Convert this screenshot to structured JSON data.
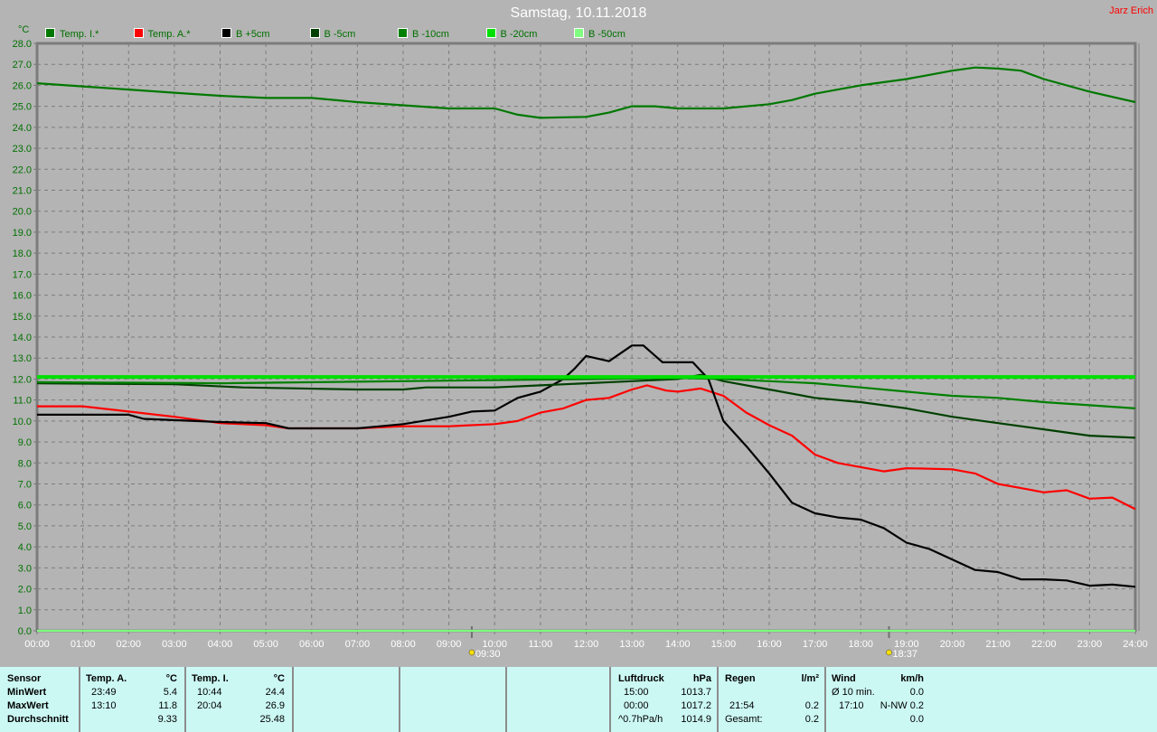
{
  "title": "Samstag, 10.11.2018",
  "author": "Jarz Erich",
  "chart_data": {
    "type": "line",
    "title": "Samstag, 10.11.2018",
    "ylabel": "°C",
    "xlabel": "",
    "ylim": [
      0,
      28
    ],
    "xlim_hours": [
      0,
      24
    ],
    "grid": true,
    "legend_position": "top-left",
    "x_tick_labels": [
      "00:00",
      "01:00",
      "02:00",
      "03:00",
      "04:00",
      "05:00",
      "06:00",
      "07:00",
      "08:00",
      "09:00",
      "10:00",
      "11:00",
      "12:00",
      "13:00",
      "14:00",
      "15:00",
      "16:00",
      "17:00",
      "18:00",
      "19:00",
      "20:00",
      "21:00",
      "22:00",
      "23:00",
      "24:00"
    ],
    "y_tick_labels": [
      "0.0",
      "1.0",
      "2.0",
      "3.0",
      "4.0",
      "5.0",
      "6.0",
      "7.0",
      "8.0",
      "9.0",
      "10.0",
      "11.0",
      "12.0",
      "13.0",
      "14.0",
      "15.0",
      "16.0",
      "17.0",
      "18.0",
      "19.0",
      "20.0",
      "21.0",
      "22.0",
      "23.0",
      "24.0",
      "25.0",
      "26.0",
      "27.0",
      "28.0"
    ],
    "annotations": [
      {
        "label": "09:30",
        "hour": 9.5,
        "icon": "sunrise-icon"
      },
      {
        "label": "18:37",
        "hour": 18.617,
        "icon": "sunset-icon"
      }
    ],
    "series": [
      {
        "name": "Temp. I.*",
        "color": "#007800",
        "x": [
          0,
          1,
          2,
          3,
          4,
          5,
          6,
          7,
          8,
          9,
          10,
          10.5,
          11,
          12,
          12.5,
          13,
          13.5,
          14,
          15,
          16,
          16.5,
          17,
          17.5,
          18,
          19,
          20,
          20.5,
          21,
          21.5,
          22,
          23,
          24
        ],
        "y": [
          26.1,
          25.95,
          25.8,
          25.65,
          25.5,
          25.4,
          25.4,
          25.2,
          25.05,
          24.9,
          24.9,
          24.6,
          24.45,
          24.5,
          24.7,
          25.0,
          25.0,
          24.9,
          24.9,
          25.1,
          25.3,
          25.6,
          25.8,
          26.0,
          26.3,
          26.7,
          26.85,
          26.8,
          26.7,
          26.3,
          25.7,
          25.2
        ]
      },
      {
        "name": "Temp. A.*",
        "color": "#ff0000",
        "x": [
          0,
          1,
          2,
          3,
          4,
          5,
          5.5,
          6,
          7,
          8,
          9,
          10,
          10.5,
          11,
          11.5,
          12,
          12.5,
          13,
          13.33,
          13.75,
          14,
          14.5,
          15,
          15.5,
          16,
          16.5,
          17,
          17.5,
          18,
          18.5,
          19,
          20,
          20.5,
          21,
          21.5,
          22,
          22.5,
          23,
          23.5,
          24
        ],
        "y": [
          10.7,
          10.7,
          10.45,
          10.2,
          9.9,
          9.8,
          9.65,
          9.65,
          9.65,
          9.75,
          9.75,
          9.85,
          10.0,
          10.4,
          10.6,
          11.0,
          11.1,
          11.5,
          11.7,
          11.45,
          11.4,
          11.55,
          11.2,
          10.4,
          9.8,
          9.3,
          8.4,
          8.0,
          7.8,
          7.6,
          7.75,
          7.7,
          7.5,
          7.0,
          6.8,
          6.6,
          6.7,
          6.3,
          6.35,
          5.8
        ]
      },
      {
        "name": "B +5cm",
        "color": "#000000",
        "x": [
          0,
          2,
          2.33,
          4,
          5,
          5.5,
          7,
          7.5,
          8,
          9,
          9.5,
          10,
          10.5,
          11,
          11.5,
          11.75,
          12,
          12.5,
          13,
          13.25,
          13.67,
          14,
          14.33,
          14.67,
          15,
          15.5,
          16,
          16.5,
          17,
          17.5,
          18,
          18.5,
          19,
          19.5,
          20,
          20.5,
          21,
          21.5,
          22,
          22.5,
          23,
          23.5,
          24
        ],
        "y": [
          10.3,
          10.3,
          10.1,
          9.95,
          9.9,
          9.65,
          9.65,
          9.75,
          9.85,
          10.2,
          10.45,
          10.5,
          11.1,
          11.4,
          12.0,
          12.5,
          13.1,
          12.85,
          13.6,
          13.6,
          12.8,
          12.8,
          12.8,
          12.0,
          10.0,
          8.8,
          7.5,
          6.1,
          5.6,
          5.4,
          5.3,
          4.9,
          4.2,
          3.9,
          3.4,
          2.9,
          2.8,
          2.45,
          2.45,
          2.4,
          2.15,
          2.2,
          2.1
        ]
      },
      {
        "name": "B -5cm",
        "color": "#004000",
        "x": [
          0,
          3,
          4.5,
          7,
          8,
          8.5,
          10,
          11,
          12,
          13,
          14,
          14.5,
          15,
          16,
          17,
          18,
          19,
          20,
          21,
          22,
          23,
          24
        ],
        "y": [
          11.8,
          11.75,
          11.6,
          11.5,
          11.5,
          11.6,
          11.6,
          11.7,
          11.8,
          11.9,
          12.0,
          12.2,
          11.9,
          11.5,
          11.1,
          10.9,
          10.6,
          10.2,
          9.9,
          9.6,
          9.3,
          9.2
        ]
      },
      {
        "name": "B -10cm",
        "color": "#008000",
        "x": [
          0,
          4,
          14,
          15,
          16,
          17,
          18,
          19,
          20,
          21,
          22,
          23,
          24
        ],
        "y": [
          11.85,
          11.8,
          12.05,
          12.0,
          11.9,
          11.8,
          11.6,
          11.4,
          11.2,
          11.1,
          10.9,
          10.75,
          10.6
        ]
      },
      {
        "name": "B -20cm",
        "color": "#00e000",
        "x": [
          0,
          24
        ],
        "y": [
          12.1,
          12.1
        ]
      },
      {
        "name": "B -50cm",
        "color": "#80ff80",
        "x": [
          0,
          24
        ],
        "y": [
          0.0,
          0.0
        ]
      }
    ]
  },
  "table": {
    "row_labels": [
      "Sensor",
      "MinWert",
      "MaxWert",
      "Durchschnitt"
    ],
    "temp_a": {
      "header": "Temp. A.",
      "unit": "°C",
      "min_time": "23:49",
      "min": "5.4",
      "max_time": "13:10",
      "max": "11.8",
      "avg": "9.33"
    },
    "temp_i": {
      "header": "Temp. I.",
      "unit": "°C",
      "min_time": "10:44",
      "min": "24.4",
      "max_time": "20:04",
      "max": "26.9",
      "avg": "25.48"
    },
    "pressure": {
      "header": "Luftdruck",
      "unit": "hPa",
      "r1_time": "15:00",
      "r1": "1013.7",
      "r2_time": "00:00",
      "r2": "1017.2",
      "r3_label": "^0.7hPa/h",
      "r3": "1014.9"
    },
    "rain": {
      "header": "Regen",
      "unit": "l/m²",
      "r2_time": "21:54",
      "r2": "0.2",
      "r3_label": "Gesamt:",
      "r3": "0.2"
    },
    "wind": {
      "header": "Wind",
      "unit": "km/h",
      "r1_label": "Ø 10 min.",
      "r1": "0.0",
      "r2_time": "17:10",
      "r2": "N-NW 0.2",
      "r3": "0.0"
    }
  }
}
